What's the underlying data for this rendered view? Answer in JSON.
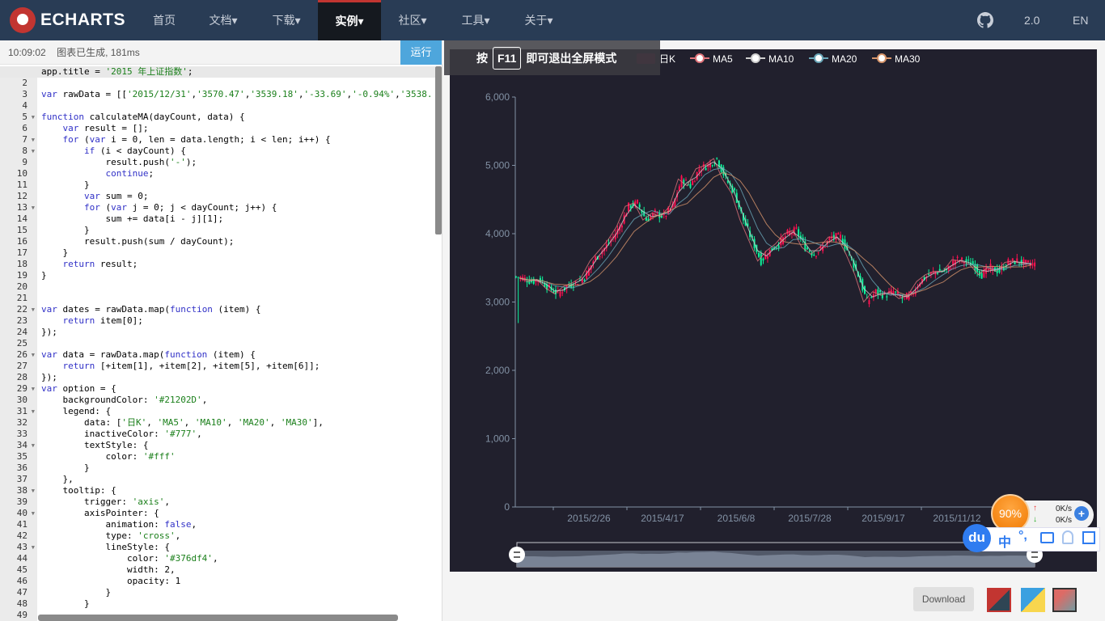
{
  "nav": {
    "logo": "ECHARTS",
    "items": [
      {
        "label": "首页"
      },
      {
        "label": "文档▾"
      },
      {
        "label": "下载▾"
      },
      {
        "label": "实例▾",
        "active": true
      },
      {
        "label": "社区▾"
      },
      {
        "label": "工具▾"
      },
      {
        "label": "关于▾"
      }
    ],
    "version": "2.0",
    "lang": "EN"
  },
  "status": {
    "time": "10:09:02",
    "message": "图表已生成, 181ms",
    "run_label": "运行"
  },
  "editor": {
    "active_line": 1,
    "fold_lines": [
      5,
      7,
      8,
      13,
      22,
      26,
      29,
      31,
      34,
      38,
      40,
      43
    ],
    "lines": [
      "app.title = '2015 年上证指数';",
      "",
      "var rawData = [['2015/12/31','3570.47','3539.18','-33.69','-0.94%','3538.",
      "",
      "function calculateMA(dayCount, data) {",
      "    var result = [];",
      "    for (var i = 0, len = data.length; i < len; i++) {",
      "        if (i < dayCount) {",
      "            result.push('-');",
      "            continue;",
      "        }",
      "        var sum = 0;",
      "        for (var j = 0; j < dayCount; j++) {",
      "            sum += data[i - j][1];",
      "        }",
      "        result.push(sum / dayCount);",
      "    }",
      "    return result;",
      "}",
      "",
      "",
      "var dates = rawData.map(function (item) {",
      "    return item[0];",
      "});",
      "",
      "var data = rawData.map(function (item) {",
      "    return [+item[1], +item[2], +item[5], +item[6]];",
      "});",
      "var option = {",
      "    backgroundColor: '#21202D',",
      "    legend: {",
      "        data: ['日K', 'MA5', 'MA10', 'MA20', 'MA30'],",
      "        inactiveColor: '#777',",
      "        textStyle: {",
      "            color: '#fff'",
      "        }",
      "    },",
      "    tooltip: {",
      "        trigger: 'axis',",
      "        axisPointer: {",
      "            animation: false,",
      "            type: 'cross',",
      "            lineStyle: {",
      "                color: '#376df4',",
      "                width: 2,",
      "                opacity: 1",
      "            }",
      "        }",
      ""
    ]
  },
  "fullscreen_tip": {
    "prefix": "按",
    "key": "F11",
    "suffix": "即可退出全屏模式"
  },
  "chart_data": {
    "type": "candlestick",
    "background": "#21202D",
    "legend": {
      "items": [
        "日K",
        "MA5",
        "MA10",
        "MA20",
        "MA30"
      ],
      "placement": "top"
    },
    "colors": {
      "up": "#FD1050",
      "down": "#0CF49B",
      "legend_k": "#5a1a32",
      "MA5": "#e0737a",
      "MA10": "#cfcfcf",
      "MA20": "#6aa6b8",
      "MA30": "#d8956b"
    },
    "ylim": [
      0,
      6000
    ],
    "yticks": [
      "0",
      "1,000",
      "2,000",
      "3,000",
      "4,000",
      "5,000",
      "6,000"
    ],
    "xticks": [
      "2015/2/26",
      "2015/4/17",
      "2015/6/8",
      "2015/7/28",
      "2015/9/17",
      "2015/11/12"
    ],
    "close": [
      3350,
      3300,
      3330,
      3200,
      3120,
      3230,
      3280,
      3360,
      3600,
      3750,
      3900,
      4100,
      4400,
      4450,
      4200,
      4300,
      4250,
      4400,
      4800,
      4700,
      4950,
      5000,
      5100,
      4800,
      4600,
      4200,
      3900,
      3600,
      3750,
      3850,
      4000,
      4050,
      3800,
      3700,
      3800,
      3950,
      3950,
      3700,
      3400,
      3000,
      3150,
      3100,
      3150,
      3050,
      3100,
      3300,
      3400,
      3450,
      3450,
      3620,
      3600,
      3550,
      3400,
      3500,
      3450,
      3580,
      3600,
      3560,
      3550
    ],
    "datazoom_range_percent": [
      0,
      100
    ]
  },
  "footer": {
    "download_label": "Download"
  },
  "widget": {
    "percent": "90%",
    "up_speed": "0K/s",
    "down_speed": "0K/s",
    "logo": "du",
    "ime": "中"
  }
}
